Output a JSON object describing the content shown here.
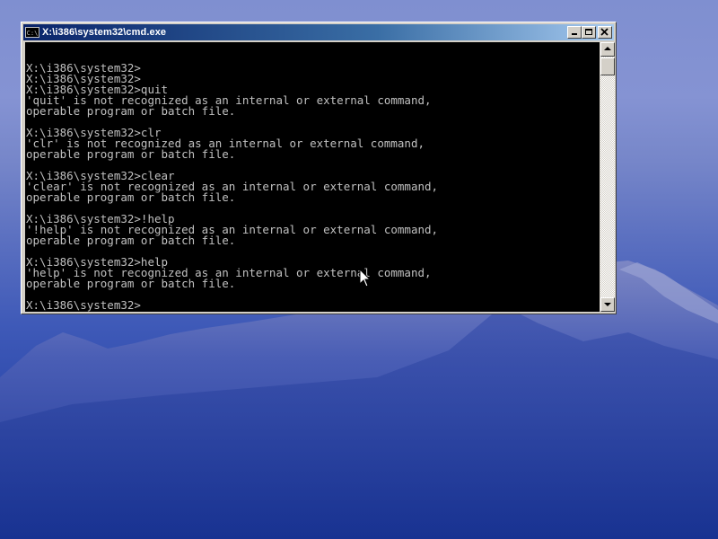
{
  "window": {
    "title": "X:\\i386\\system32\\cmd.exe",
    "icon_label": "C:\\"
  },
  "console": {
    "lines": [
      "X:\\i386\\system32>",
      "X:\\i386\\system32>",
      "X:\\i386\\system32>quit",
      "'quit' is not recognized as an internal or external command,",
      "operable program or batch file.",
      "",
      "X:\\i386\\system32>clr",
      "'clr' is not recognized as an internal or external command,",
      "operable program or batch file.",
      "",
      "X:\\i386\\system32>clear",
      "'clear' is not recognized as an internal or external command,",
      "operable program or batch file.",
      "",
      "X:\\i386\\system32>!help",
      "'!help' is not recognized as an internal or external command,",
      "operable program or batch file.",
      "",
      "X:\\i386\\system32>help",
      "'help' is not recognized as an internal or external command,",
      "operable program or batch file.",
      "",
      "X:\\i386\\system32>"
    ]
  },
  "icons": {
    "app": "cmd-icon",
    "minimize": "minimize-icon",
    "maximize": "maximize-icon",
    "close": "close-icon",
    "scroll_up": "scroll-up-icon",
    "scroll_down": "scroll-down-icon",
    "pointer": "mouse-pointer-icon"
  },
  "colors": {
    "console_bg": "#000000",
    "console_text": "#c0c0c0",
    "titlebar_start": "#0a246a",
    "titlebar_end": "#a6caf0"
  }
}
